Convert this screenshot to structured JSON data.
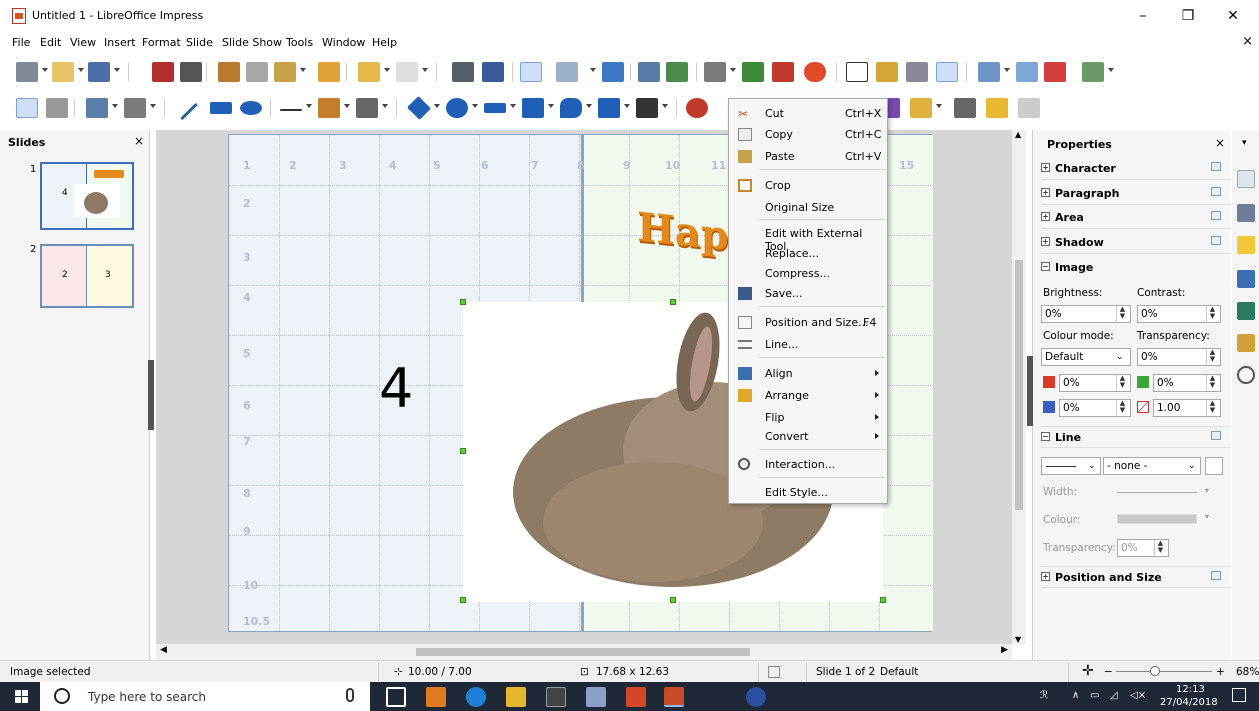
{
  "window": {
    "title": "Untitled 1 - LibreOffice Impress",
    "minimize": "–",
    "maximize": "❐",
    "close": "✕",
    "doc_close": "×"
  },
  "menu": [
    "File",
    "Edit",
    "View",
    "Insert",
    "Format",
    "Slide",
    "Slide Show",
    "Tools",
    "Window",
    "Help"
  ],
  "slides_panel": {
    "title": "Slides",
    "close": "×",
    "slides": [
      {
        "number": "1",
        "label": "4"
      },
      {
        "number": "2",
        "labels": [
          "2",
          "3"
        ]
      }
    ]
  },
  "slide": {
    "ruler_top": [
      "1",
      "2",
      "3",
      "4",
      "5",
      "6",
      "7",
      "8",
      "9",
      "10",
      "11",
      "15"
    ],
    "ruler_left": [
      "2",
      "3",
      "4",
      "5",
      "6",
      "7",
      "8",
      "9",
      "10",
      "10.5"
    ],
    "big_number": "4",
    "wordart": "Happy"
  },
  "context_menu": {
    "items": [
      {
        "label": "Cut",
        "shortcut": "Ctrl+X",
        "icon": "scissors-icon"
      },
      {
        "label": "Copy",
        "shortcut": "Ctrl+C",
        "icon": "copy-icon"
      },
      {
        "label": "Paste",
        "shortcut": "Ctrl+V",
        "icon": "paste-icon"
      },
      {
        "label": "Crop",
        "icon": "crop-icon"
      },
      {
        "label": "Original Size"
      },
      {
        "label": "Edit with External Tool"
      },
      {
        "label": "Replace..."
      },
      {
        "label": "Compress..."
      },
      {
        "label": "Save...",
        "icon": "save-icon"
      },
      {
        "label": "Position and Size...",
        "shortcut": "F4",
        "icon": "position-size-icon"
      },
      {
        "label": "Line...",
        "icon": "line-icon"
      },
      {
        "label": "Align",
        "icon": "align-icon",
        "submenu": true
      },
      {
        "label": "Arrange",
        "icon": "arrange-icon",
        "submenu": true
      },
      {
        "label": "Flip",
        "submenu": true
      },
      {
        "label": "Convert",
        "submenu": true
      },
      {
        "label": "Interaction...",
        "icon": "interaction-icon"
      },
      {
        "label": "Edit Style..."
      }
    ]
  },
  "properties": {
    "title": "Properties",
    "close": "×",
    "sections": [
      "Character",
      "Paragraph",
      "Area",
      "Shadow",
      "Image",
      "Line",
      "Position and Size"
    ],
    "image": {
      "brightness_label": "Brightness:",
      "brightness_value": "0%",
      "contrast_label": "Contrast:",
      "contrast_value": "0%",
      "colour_mode_label": "Colour mode:",
      "colour_mode_value": "Default",
      "transparency_label": "Transparency:",
      "transparency_value": "0%",
      "red_value": "0%",
      "green_value": "0%",
      "blue_value": "0%",
      "gamma_value": "1.00"
    },
    "line": {
      "style_value": "- none -",
      "width_label": "Width:",
      "colour_label": "Colour:",
      "transparency_label": "Transparency:",
      "transparency_value": "0%"
    }
  },
  "status_bar": {
    "mode": "Image selected",
    "position": "10.00 / 7.00",
    "size": "17.68 x 12.63",
    "slide_info": "Slide 1 of 2",
    "layout": "Default",
    "zoom": "68%"
  },
  "taskbar": {
    "search_placeholder": "Type here to search",
    "time": "12:13",
    "date": "27/04/2018"
  },
  "colors": {
    "accent_blue": "#3b6fb6",
    "selection_handle": "#5ccc3a",
    "taskbar": "#1f2836"
  }
}
